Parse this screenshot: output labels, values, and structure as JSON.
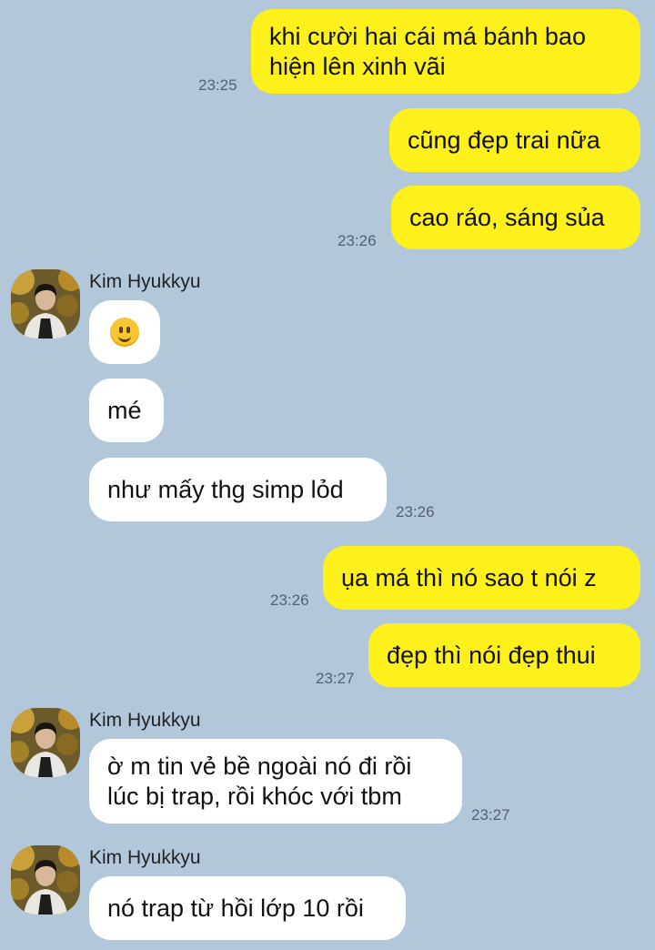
{
  "contact": {
    "name": "Kim Hyukkyu"
  },
  "messages": [
    {
      "sender": "me",
      "text": "khi cười hai cái má bánh bao\nhiện lên xinh vãi",
      "time": "23:25"
    },
    {
      "sender": "me",
      "text": "cũng đẹp trai nữa",
      "time": ""
    },
    {
      "sender": "me",
      "text": "cao ráo, sáng sủa",
      "time": "23:26"
    },
    {
      "sender": "them",
      "text": "",
      "icon": "slightly-smiling-face-icon",
      "time": ""
    },
    {
      "sender": "them",
      "text": "mé",
      "time": ""
    },
    {
      "sender": "them",
      "text": "như mấy thg simp lỏd",
      "time": "23:26"
    },
    {
      "sender": "me",
      "text": "ụa má thì nó sao t nói z",
      "time": "23:26"
    },
    {
      "sender": "me",
      "text": "đẹp thì nói đẹp thui",
      "time": "23:27"
    },
    {
      "sender": "them",
      "text": "ờ m tin vẻ bề ngoài nó đi rồi\nlúc bị trap, rồi khóc với tbm",
      "time": "23:27"
    },
    {
      "sender": "them",
      "text": "nó trap từ hồi lớp 10 rồi",
      "time": ""
    }
  ],
  "colors": {
    "background": "#b2c7d9",
    "my_bubble": "#fef01b",
    "their_bubble": "#ffffff",
    "timestamp": "#556270"
  }
}
